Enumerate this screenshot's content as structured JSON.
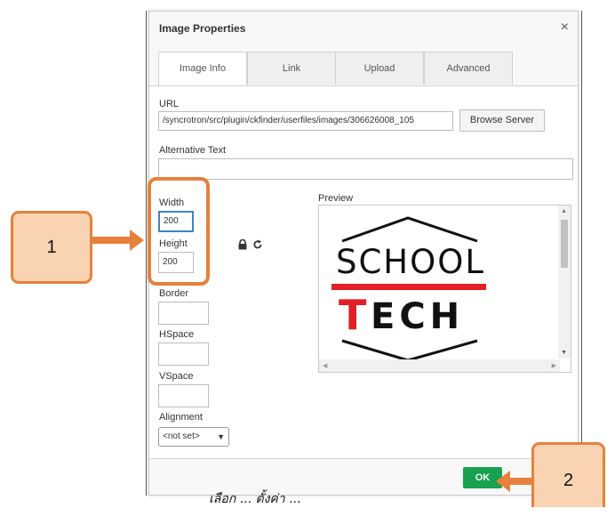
{
  "dialog": {
    "title": "Image Properties",
    "close_glyph": "×",
    "tabs": [
      {
        "label": "Image Info",
        "active": true
      },
      {
        "label": "Link",
        "active": false
      },
      {
        "label": "Upload",
        "active": false
      },
      {
        "label": "Advanced",
        "active": false
      }
    ]
  },
  "form": {
    "url_label": "URL",
    "url_value": "/syncrotron/src/plugin/ckfinder/userfiles/images/306626008_105",
    "browse_label": "Browse Server",
    "alt_label": "Alternative Text",
    "alt_value": "",
    "width_label": "Width",
    "width_value": "200",
    "height_label": "Height",
    "height_value": "200",
    "border_label": "Border",
    "hspace_label": "HSpace",
    "vspace_label": "VSpace",
    "alignment_label": "Alignment",
    "alignment_value": "<not set>",
    "preview_label": "Preview"
  },
  "preview": {
    "logo_line1": "SCHOOL",
    "logo_line2_first": "T",
    "logo_line2_rest": "ECH",
    "logo_accent_color": "#e21f26"
  },
  "footer": {
    "ok_label": "OK"
  },
  "annotations": {
    "callout_1": "1",
    "callout_2": "2",
    "accent_color": "#e7803a"
  },
  "bottom_caption": "เลือก ... ตั้งค่า ..."
}
